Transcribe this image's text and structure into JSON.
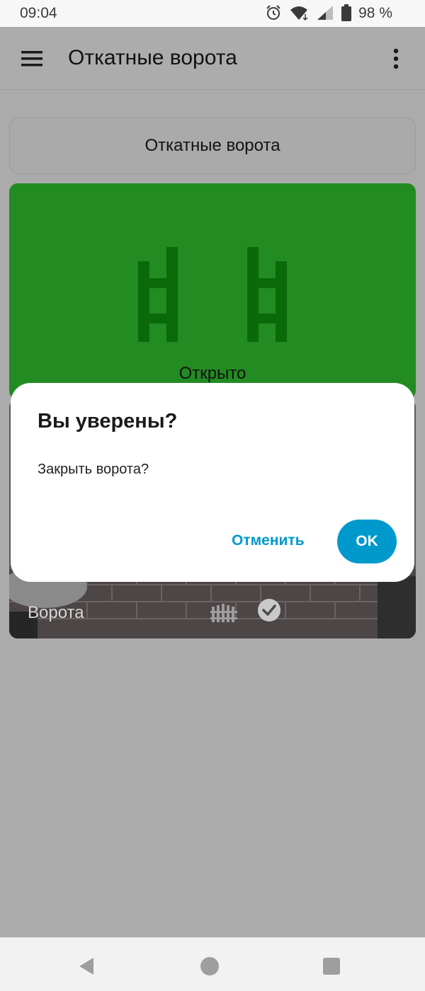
{
  "status_bar": {
    "time": "09:04",
    "battery": "98 %"
  },
  "app_bar": {
    "title": "Откатные ворота"
  },
  "selector": {
    "label": "Откатные ворота"
  },
  "gate_card": {
    "status": "Открыто",
    "color": "#228b22"
  },
  "camera_card": {
    "label": "Ворота"
  },
  "dialog": {
    "title": "Вы уверены?",
    "message": "Закрыть ворота?",
    "cancel": "Отменить",
    "ok": "OK",
    "accent": "#0099cc"
  }
}
